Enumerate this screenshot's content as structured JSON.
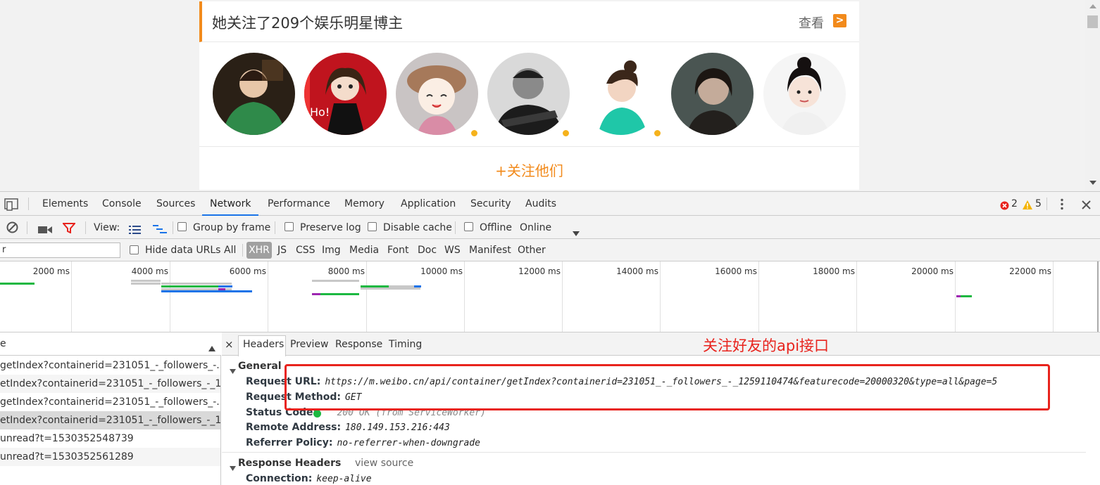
{
  "page": {
    "card_title": "她关注了209个娱乐明星博主",
    "view_label": "查看",
    "view_arrow": ">",
    "follow_label": "+关注他们",
    "avatars": [
      "avatar-1",
      "avatar-2",
      "avatar-3",
      "avatar-4",
      "avatar-5",
      "avatar-6",
      "avatar-7"
    ]
  },
  "devtools": {
    "tabs": [
      "Elements",
      "Console",
      "Sources",
      "Network",
      "Performance",
      "Memory",
      "Application",
      "Security",
      "Audits"
    ],
    "active_tab": "Network",
    "error_count": "2",
    "warning_count": "5",
    "toolbar": {
      "view_label": "View:",
      "group_by_frame": "Group by frame",
      "preserve_log": "Preserve log",
      "disable_cache": "Disable cache",
      "offline": "Offline",
      "throttle": "Online"
    },
    "filter": {
      "placeholder": "r",
      "hide_data_urls": "Hide data URLs",
      "types": [
        "All",
        "XHR",
        "JS",
        "CSS",
        "Img",
        "Media",
        "Font",
        "Doc",
        "WS",
        "Manifest",
        "Other"
      ],
      "active_type": "XHR"
    },
    "timeline_labels": [
      "2000 ms",
      "4000 ms",
      "6000 ms",
      "8000 ms",
      "10000 ms",
      "12000 ms",
      "14000 ms",
      "16000 ms",
      "18000 ms",
      "20000 ms",
      "22000 ms"
    ],
    "request_list": {
      "header": "e",
      "rows": [
        "getIndex?containerid=231051_-_followers_-...",
        "etIndex?containerid=231051_-_followers_-_1...",
        "getIndex?containerid=231051_-_followers_-...",
        "etIndex?containerid=231051_-_followers_-_1...",
        "unread?t=1530352548739",
        "unread?t=1530352561289"
      ]
    },
    "detail": {
      "close": "×",
      "tabs": [
        "Headers",
        "Preview",
        "Response",
        "Timing"
      ],
      "general_title": "General",
      "general": [
        {
          "key": "Request URL:",
          "value": "https://m.weibo.cn/api/container/getIndex?containerid=231051_-_followers_-_1259110474&featurecode=20000320&type=all&page=5"
        },
        {
          "key": "Request Method:",
          "value": "GET"
        },
        {
          "key": "Status Code:",
          "value": "200 OK (from ServiceWorker)"
        },
        {
          "key": "Remote Address:",
          "value": "180.149.153.216:443"
        },
        {
          "key": "Referrer Policy:",
          "value": "no-referrer-when-downgrade"
        }
      ],
      "response_headers_title": "Response Headers",
      "view_source": "view source",
      "response_headers": [
        {
          "key": "Connection:",
          "value": "keep-alive"
        }
      ]
    },
    "annotation": "关注好友的api接口"
  },
  "colors": {
    "accent_orange": "#f28a1b",
    "annotation_red": "#e8231d",
    "devtools_blue": "#1a73e8",
    "status_green": "#1cb841"
  }
}
